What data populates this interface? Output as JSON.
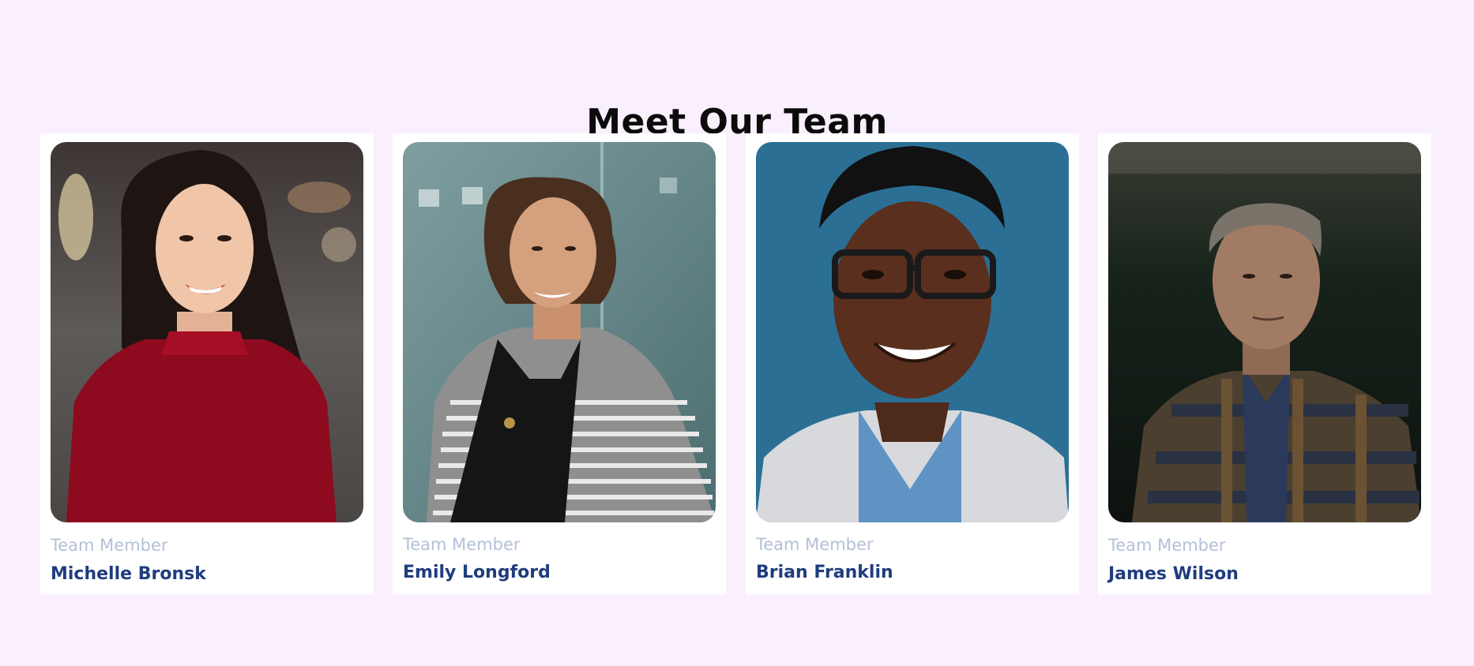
{
  "page": {
    "title": "Meet Our Team",
    "background": "#f9effd"
  },
  "team": [
    {
      "role": "Team Member",
      "name": "Michelle Bronsk"
    },
    {
      "role": "Team Member",
      "name": "Emily Longford"
    },
    {
      "role": "Team Member",
      "name": "Brian Franklin"
    },
    {
      "role": "Team Member",
      "name": "James Wilson"
    }
  ],
  "colors": {
    "title": "#0b0b0b",
    "role": "#b4c0d8",
    "name": "#1f3c7e",
    "card": "#ffffff"
  }
}
